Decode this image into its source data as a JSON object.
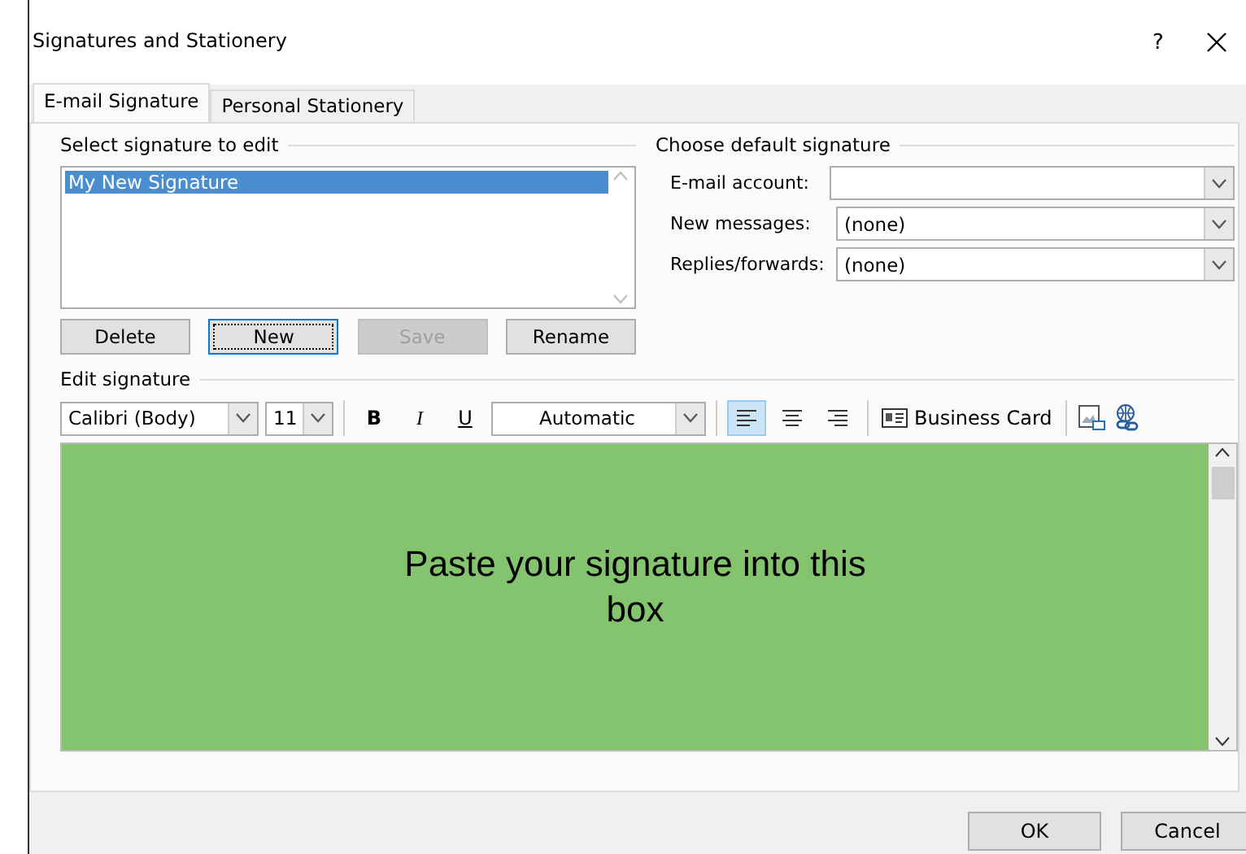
{
  "window": {
    "title": "Signatures and Stationery",
    "help": "?"
  },
  "tabs": [
    {
      "label": "E-mail Signature",
      "selected": true
    },
    {
      "label": "Personal Stationery",
      "selected": false
    }
  ],
  "select_signature": {
    "heading": "Select signature to edit",
    "items": [
      {
        "label": "My New Signature",
        "selected": true
      }
    ],
    "buttons": [
      {
        "label": "Delete",
        "disabled": false,
        "focused": false
      },
      {
        "label": "New",
        "disabled": false,
        "focused": true
      },
      {
        "label": "Save",
        "disabled": true,
        "focused": false
      },
      {
        "label": "Rename",
        "disabled": false,
        "focused": false
      }
    ]
  },
  "default_signature": {
    "heading": "Choose default signature",
    "fields": [
      {
        "label": "E-mail account:"
      },
      {
        "label": "New messages:",
        "value": "(none)"
      },
      {
        "label": "Replies/forwards:",
        "value": "(none)"
      }
    ]
  },
  "edit_signature": {
    "heading": "Edit signature",
    "font": "Calibri (Body)",
    "size": "11",
    "bold": "B",
    "italic": "I",
    "underline": "U",
    "font_color": "Automatic",
    "alignment": [
      {
        "kind": "left",
        "selected": true
      },
      {
        "kind": "center",
        "selected": false
      },
      {
        "kind": "right",
        "selected": false
      }
    ],
    "business_card": "Business Card",
    "content": "Paste your signature into this box"
  },
  "footer_buttons": [
    "OK",
    "Cancel"
  ]
}
